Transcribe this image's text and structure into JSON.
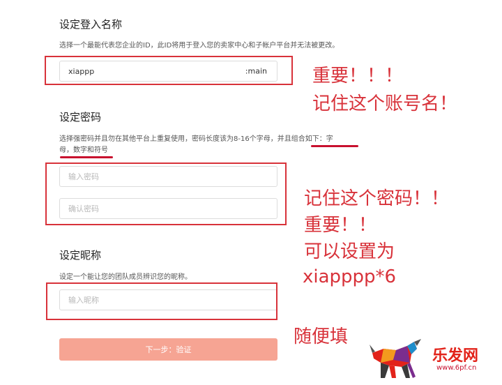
{
  "login_section": {
    "title": "设定登入名称",
    "description": "选择一个最能代表您企业的ID，此ID将用于登入您的卖家中心和子帐户平台并无法被更改。",
    "input_value": "xiappp",
    "input_suffix": ":main"
  },
  "password_section": {
    "title": "设定密码",
    "description_line1": "选择强密码并且勿在其他平台上重复使用，密码长度该为8-16个字母，并且组合如下：字",
    "description_line2": "母，数字和符号",
    "password_placeholder": "输入密码",
    "confirm_placeholder": "确认密码"
  },
  "nickname_section": {
    "title": "设定昵称",
    "description": "设定一个能让您的团队成员辨识您的昵称。",
    "nickname_placeholder": "输入昵称"
  },
  "next_button": "下一步：验证",
  "annotations": {
    "login_note_line1": "重要！！！",
    "login_note_line2": "记住这个账号名！",
    "password_note_line1": "记住这个密码！！",
    "password_note_line2": "重要！！",
    "password_note_line3": "可以设置为",
    "password_note_line4": "xiapppp*6",
    "nickname_note": "随便填"
  },
  "watermark": {
    "brand": "乐发网",
    "url": "www.6pf.cn"
  },
  "colors": {
    "annotation_red": "#d8323a",
    "button_bg": "#f6a493",
    "input_border": "#dcdcdc"
  }
}
